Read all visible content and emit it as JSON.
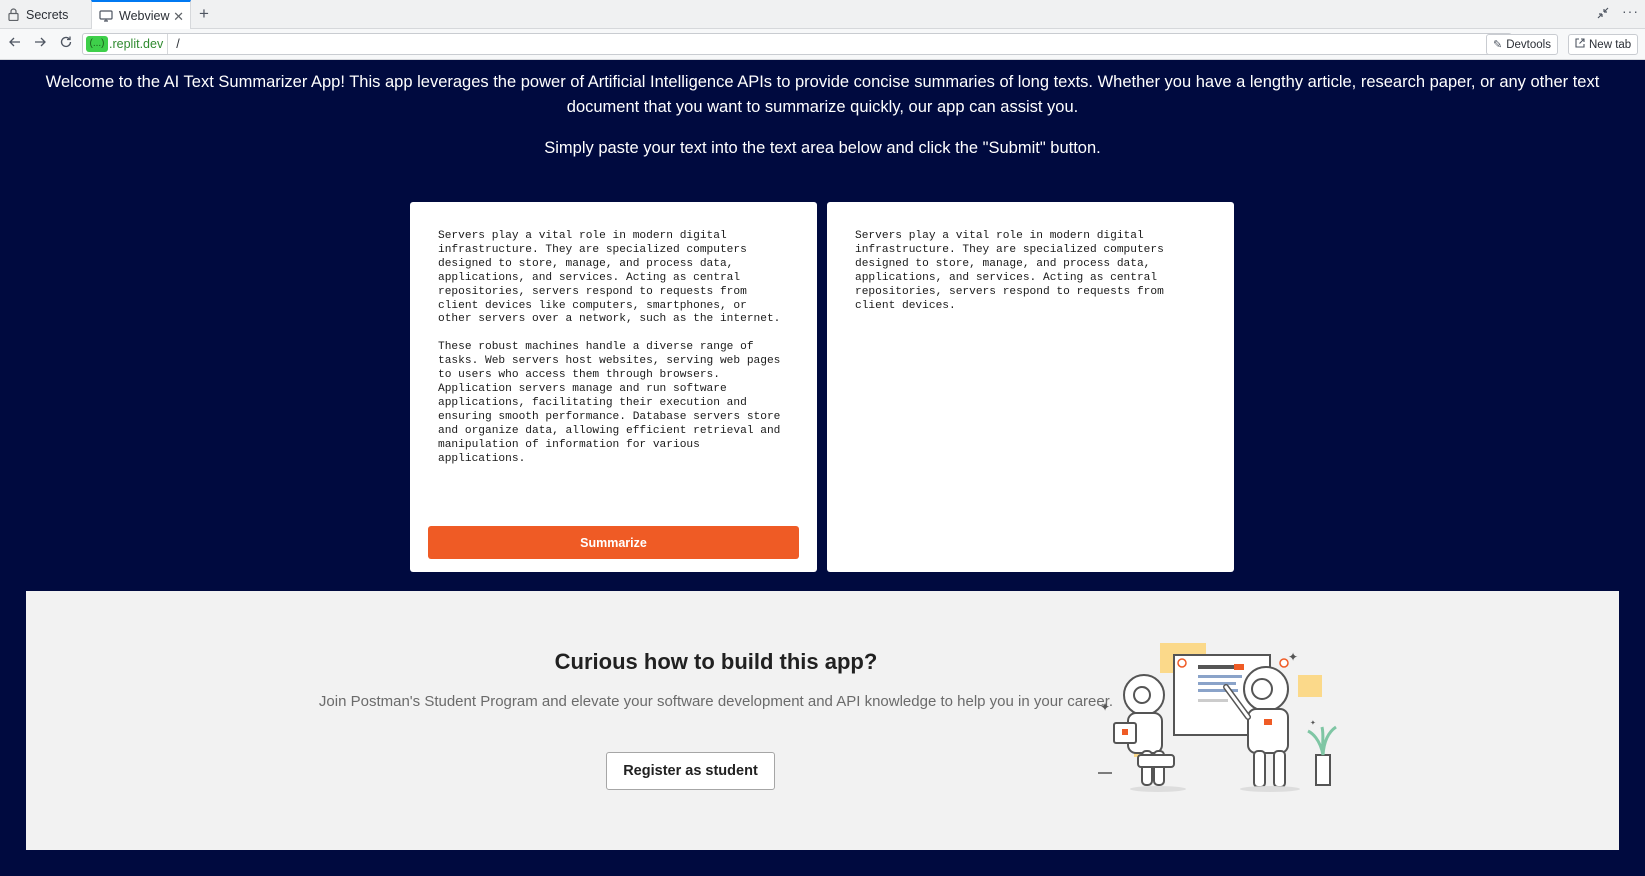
{
  "tabs": [
    {
      "label": "Secrets",
      "icon": "lock-icon"
    },
    {
      "label": "Webview",
      "icon": "monitor-icon",
      "active": true
    }
  ],
  "address": {
    "redacted": "(...)",
    "host": ".replit.dev",
    "path": "/"
  },
  "toolbar": {
    "devtools": "Devtools",
    "new_tab": "New tab"
  },
  "page": {
    "intro": "Welcome to the AI Text Summarizer App! This app leverages the power of Artificial Intelligence APIs to provide concise summaries of long texts. Whether you have a lengthy article, research paper, or any other text document that you want to summarize quickly, our app can assist you.",
    "instructions": "Simply paste your text into the text area below and click the \"Submit\" button.",
    "input_text": "Servers play a vital role in modern digital\ninfrastructure. They are specialized computers\ndesigned to store, manage, and process data,\napplications, and services. Acting as central\nrepositories, servers respond to requests from\nclient devices like computers, smartphones, or\nother servers over a network, such as the internet.\n\nThese robust machines handle a diverse range of\ntasks. Web servers host websites, serving web pages\nto users who access them through browsers.\nApplication servers manage and run software\napplications, facilitating their execution and\nensuring smooth performance. Database servers store\nand organize data, allowing efficient retrieval and\nmanipulation of information for various\napplications.",
    "summarize_label": "Summarize",
    "output_text": "Servers play a vital role in modern digital\ninfrastructure. They are specialized computers\ndesigned to store, manage, and process data,\napplications, and services. Acting as central\nrepositories, servers respond to requests from\nclient devices."
  },
  "promo": {
    "title": "Curious how to build this app?",
    "text": "Join Postman's Student Program and elevate your software development and API knowledge to help you in your career.",
    "button": "Register as student",
    "illustration": "astronauts-whiteboard-illustration"
  },
  "colors": {
    "page_bg": "#000a3f",
    "accent": "#ef5b25",
    "promo_bg": "#f2f2f2",
    "tab_active_border": "#0079f2"
  }
}
